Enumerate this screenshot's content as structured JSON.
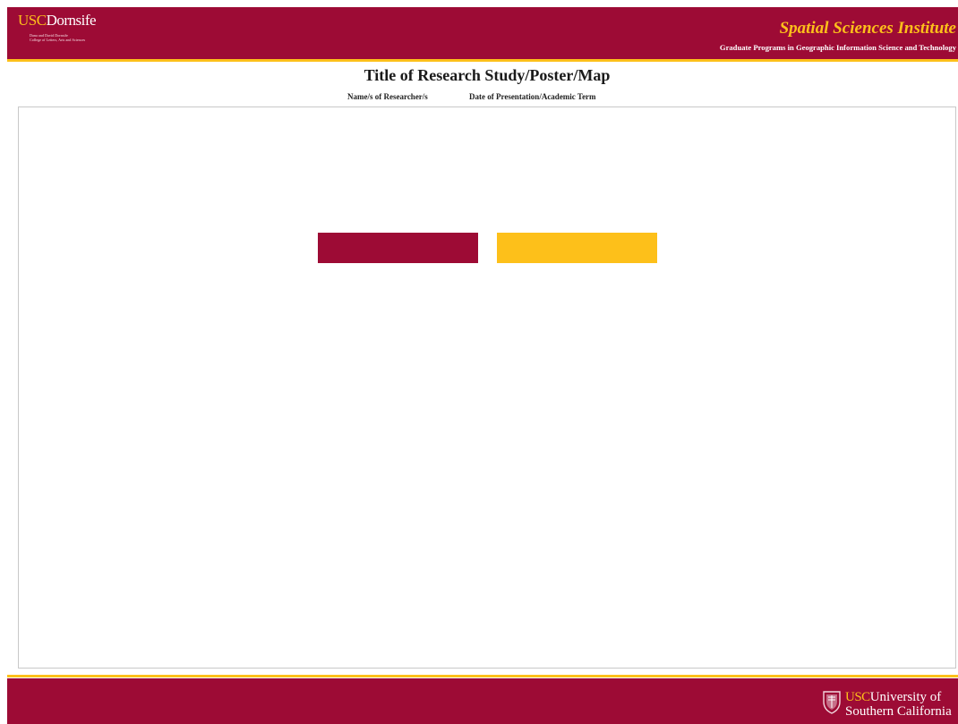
{
  "colors": {
    "cardinal": "#9d0b35",
    "gold": "#fdc01a",
    "frame_border": "#c8c8c8"
  },
  "header": {
    "dornsife_logo": {
      "usc": "USC",
      "name": "Dornsife",
      "subline1": "Dana and David Dornsife",
      "subline2": "College of Letters, Arts and Sciences"
    },
    "institute_title": "Spatial Sciences Institute",
    "institute_subtitle": "Graduate Programs in Geographic Information Science and Technology"
  },
  "poster": {
    "title": "Title of Research Study/Poster/Map",
    "researchers": "Name/s of Researcher/s",
    "date_term": "Date of Presentation/Academic Term"
  },
  "footer": {
    "seal_icon": "usc-seal-icon",
    "usc_logo": {
      "usc": "USC",
      "line1": "University of",
      "line2": "Southern California"
    }
  }
}
